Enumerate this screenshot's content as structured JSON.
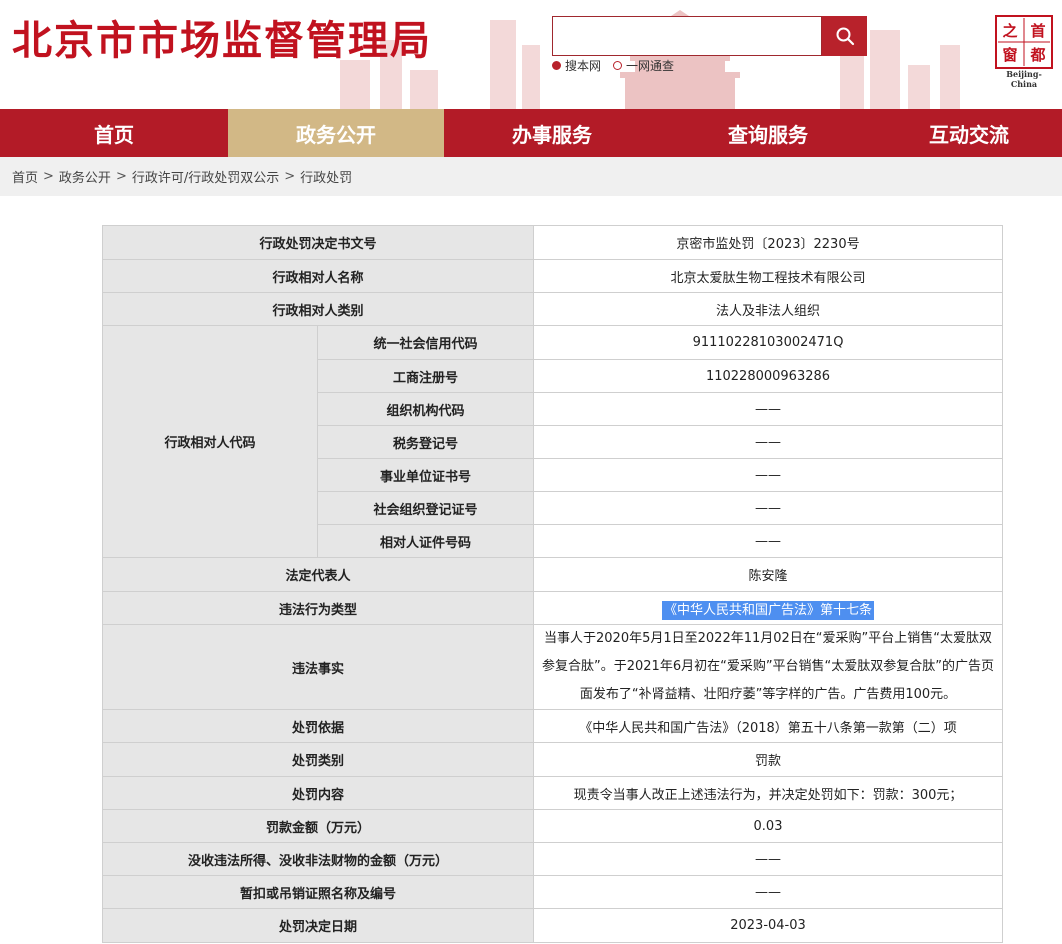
{
  "header": {
    "site_title": "北京市市场监督管理局",
    "search": {
      "value": "",
      "placeholder": "",
      "options": [
        {
          "label": "搜本网",
          "selected": true
        },
        {
          "label": "一网通查",
          "selected": false
        }
      ]
    },
    "logo": {
      "chars": [
        "首",
        "都",
        "之",
        "窗"
      ],
      "caption": "Beijing-China"
    }
  },
  "nav": {
    "items": [
      {
        "label": "首页",
        "active": false
      },
      {
        "label": "政务公开",
        "active": true
      },
      {
        "label": "办事服务",
        "active": false
      },
      {
        "label": "查询服务",
        "active": false
      },
      {
        "label": "互动交流",
        "active": false
      }
    ]
  },
  "breadcrumb": {
    "items": [
      "首页",
      "政务公开",
      "行政许可/行政处罚双公示",
      "行政处罚"
    ],
    "separator": ">"
  },
  "record": {
    "doc_no": {
      "label": "行政处罚决定书文号",
      "value": "京密市监处罚〔2023〕2230号"
    },
    "party_name": {
      "label": "行政相对人名称",
      "value": "北京太爱肽生物工程技术有限公司"
    },
    "party_type": {
      "label": "行政相对人类别",
      "value": "法人及非法人组织"
    },
    "party_code": {
      "label": "行政相对人代码",
      "rows": [
        {
          "label": "统一社会信用代码",
          "value": "91110228103002471Q"
        },
        {
          "label": "工商注册号",
          "value": "110228000963286"
        },
        {
          "label": "组织机构代码",
          "value": "——"
        },
        {
          "label": "税务登记号",
          "value": "——"
        },
        {
          "label": "事业单位证书号",
          "value": "——"
        },
        {
          "label": "社会组织登记证号",
          "value": "——"
        },
        {
          "label": "相对人证件号码",
          "value": "——"
        }
      ]
    },
    "legal_rep": {
      "label": "法定代表人",
      "value": "陈安隆"
    },
    "violation_type": {
      "label": "违法行为类型",
      "value": "《中华人民共和国广告法》第十七条"
    },
    "violation_facts": {
      "label": "违法事实",
      "lines": [
        "当事人于2020年5月1日至2022年11月02日在“爱采购”平台上销售“太爱肽双",
        "参复合肽”。于2021年6月初在“爱采购”平台销售“太爱肽双参复合肽”的广告页",
        "面发布了“补肾益精、壮阳疗萎”等字样的广告。广告费用100元。"
      ]
    },
    "basis": {
      "label": "处罚依据",
      "value": "《中华人民共和国广告法》（2018）第五十八条第一款第（二）项"
    },
    "category": {
      "label": "处罚类别",
      "value": "罚款"
    },
    "content": {
      "label": "处罚内容",
      "value": "现责令当事人改正上述违法行为，并决定处罚如下：罚款：300元；"
    },
    "fine": {
      "label": "罚款金额（万元）",
      "value": "0.03"
    },
    "confiscation": {
      "label": "没收违法所得、没收非法财物的金额（万元）",
      "value": "——"
    },
    "license": {
      "label": "暂扣或吊销证照名称及编号",
      "value": "——"
    },
    "decision_date": {
      "label": "处罚决定日期",
      "value": "2023-04-03"
    }
  },
  "colors": {
    "brand_red": "#b31b27",
    "active_tab": "#d2b886",
    "label_bg": "#e6e6e6",
    "highlight": "#4e8ff0"
  }
}
